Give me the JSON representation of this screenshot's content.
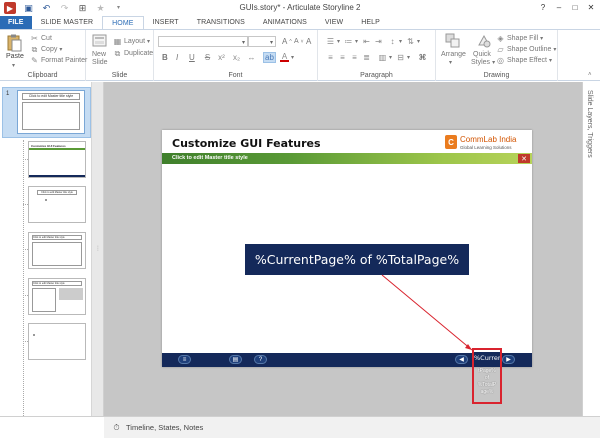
{
  "window": {
    "title": "GUIs.story* - Articulate Storyline 2",
    "controls": [
      "?",
      "–",
      "□",
      "✕"
    ]
  },
  "tabs": {
    "items": [
      "FILE",
      "SLIDE MASTER",
      "HOME",
      "INSERT",
      "TRANSITIONS",
      "ANIMATIONS",
      "VIEW",
      "HELP"
    ],
    "active": "HOME"
  },
  "ribbon": {
    "clipboard": {
      "paste": "Paste",
      "cut": "Cut",
      "copy": "Copy",
      "format_painter": "Format Painter",
      "label": "Clipboard"
    },
    "slide": {
      "new_slide": "New",
      "new_slide_2": "Slide",
      "layout": "Layout",
      "duplicate": "Duplicate",
      "label": "Slide"
    },
    "font": {
      "label": "Font",
      "bold": "B",
      "italic": "I",
      "underline": "U",
      "superscript": "A",
      "shrink": "A",
      "clear": "A"
    },
    "paragraph": {
      "label": "Paragraph"
    },
    "drawing": {
      "arrange": "Arrange",
      "quick_styles": "Quick",
      "quick_styles_2": "Styles",
      "shape_fill": "Shape Fill",
      "shape_outline": "Shape Outline",
      "shape_effect": "Shape Effect",
      "label": "Drawing"
    }
  },
  "thumbnails": [
    {
      "num": "1",
      "title": "Click to edit Master title style",
      "selected": true
    },
    {
      "num": "",
      "title": "Customize GUI Features"
    },
    {
      "num": "",
      "title": "Click to edit Master title style"
    },
    {
      "num": "",
      "title": "Click to edit Master title style"
    },
    {
      "num": "",
      "title": "Click to edit Master title style"
    },
    {
      "num": "",
      "title": ""
    }
  ],
  "slide": {
    "title": "Customize GUI Features",
    "logo_name": "CommLab India",
    "logo_tag": "Global Learning Solutions",
    "master_title": "Click to edit Master title style",
    "close_glyph": "✕",
    "page_counter": "%CurrentPage% of %TotalPage%",
    "overflow_text": "%Curren",
    "overflow_rest": "tPage%\nof\n%TotalP\nage%",
    "nav": {
      "menu": "≡",
      "glossary": "▤",
      "help": "?",
      "prev": "◀",
      "next": "▶"
    }
  },
  "right_panel": {
    "label": "Slide Layers, Triggers"
  },
  "bottom": {
    "label": "Timeline, States, Notes"
  }
}
